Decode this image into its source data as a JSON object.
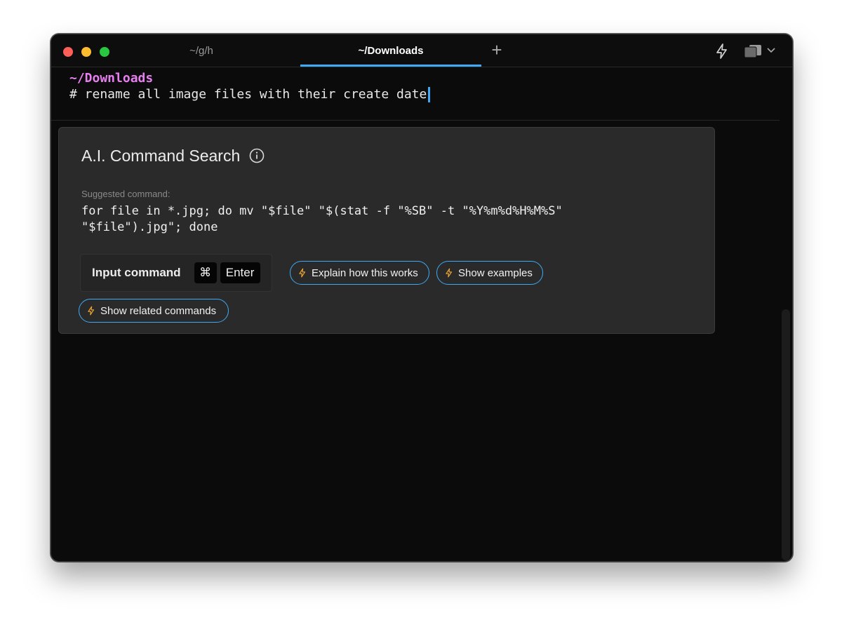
{
  "tabs": [
    {
      "label": "~/g/h",
      "active": false
    },
    {
      "label": "~/Downloads",
      "active": true
    }
  ],
  "titlebar": {
    "new_tab_icon": "plus-icon",
    "ai_icon": "lightning-bolt-icon",
    "layout_icon": "window-layout-icon",
    "menu_icon": "chevron-down-icon"
  },
  "terminal": {
    "current_dir": "~/Downloads",
    "input_text": "# rename all image files with their create date"
  },
  "ai_panel": {
    "title": "A.I. Command Search",
    "info_icon": "info-icon",
    "suggested_label": "Suggested command:",
    "suggested_command": "for file in *.jpg; do mv \"$file\" \"$(stat -f \"%SB\" -t \"%Y%m%d%H%M%S\"\n\"$file\").jpg\"; done",
    "input_command": {
      "label": "Input command",
      "key_modifier": "⌘",
      "key_main": "Enter"
    },
    "actions": [
      {
        "label": "Explain how this works",
        "icon": "lightning-bolt-icon"
      },
      {
        "label": "Show examples",
        "icon": "lightning-bolt-icon"
      },
      {
        "label": "Show related commands",
        "icon": "lightning-bolt-icon"
      }
    ]
  },
  "colors": {
    "accent": "#3fa9f5",
    "prompt_dir": "#e87ff0",
    "bolt": "#f0a830",
    "window_bg": "#0b0b0b",
    "panel_bg": "#2a2a2a"
  }
}
